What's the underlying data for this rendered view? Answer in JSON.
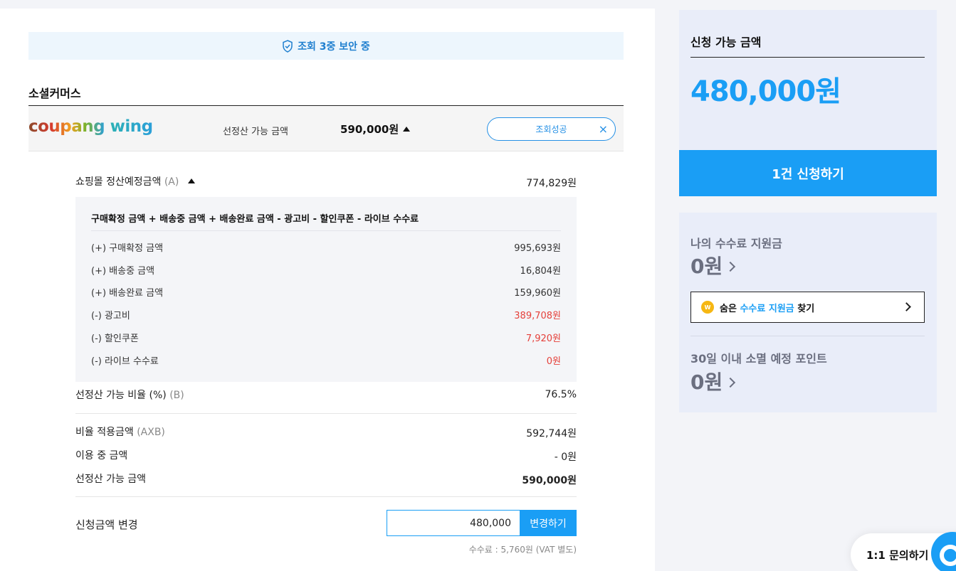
{
  "security_text": "조회 3중 보안 중",
  "section_title": "소셜커머스",
  "seller": {
    "logo": {
      "part1": "coupang",
      "part2": " wing"
    },
    "available_label": "선정산 가능 금액",
    "available_amount": "590,000원",
    "status": "조회성공",
    "close": "×"
  },
  "details": {
    "settlement_label": "쇼핑몰 정산예정금액",
    "settlement_suffix": "(A)",
    "settlement_value": "774,829원",
    "formula": "구매확정 금액 + 배송중 금액 + 배송완료 금액 - 광고비 - 할인쿠폰 - 라이브 수수료",
    "breakdown": [
      {
        "label": "(+) 구매확정 금액",
        "value": "995,693원"
      },
      {
        "label": "(+) 배송중 금액",
        "value": "16,804원"
      },
      {
        "label": "(+) 배송완료 금액",
        "value": "159,960원"
      },
      {
        "label": "(-) 광고비",
        "value": "389,708원"
      },
      {
        "label": "(-) 할인쿠폰",
        "value": "7,920원"
      },
      {
        "label": "(-) 라이브 수수료",
        "value": "0원"
      }
    ],
    "ratio_label": "선정산 가능 비율 (%)",
    "ratio_suffix": "(B)",
    "ratio_value": "76.5%",
    "applied_label": "비율 적용금액",
    "applied_suffix": "(AXB)",
    "applied_value": "592,744원",
    "inuse_label": "이용 중 금액",
    "inuse_value": "- 0원",
    "final_label": "선정산 가능 금액",
    "final_value": "590,000원"
  },
  "change": {
    "label": "신청금액 변경",
    "input_value": "480,000",
    "button": "변경하기",
    "fee_note": "수수료 : 5,760원 (VAT 별도)"
  },
  "sidebar": {
    "apply_label": "신청 가능 금액",
    "apply_amount": "480,000원",
    "apply_button": "1건 신청하기",
    "fee_support_label": "나의 수수료 지원금",
    "fee_support_value": "0원",
    "hidden": {
      "pre": "숨은 ",
      "highlight": "수수료 지원금",
      "post": " 찾기",
      "coin": "W"
    },
    "expiring_label": "30일 이내 소멸 예정 포인트",
    "expiring_value": "0원"
  },
  "inquiry": "1:1 문의하기",
  "colors": {
    "accent": "#1a9ef5",
    "negative": "#e5413b"
  }
}
